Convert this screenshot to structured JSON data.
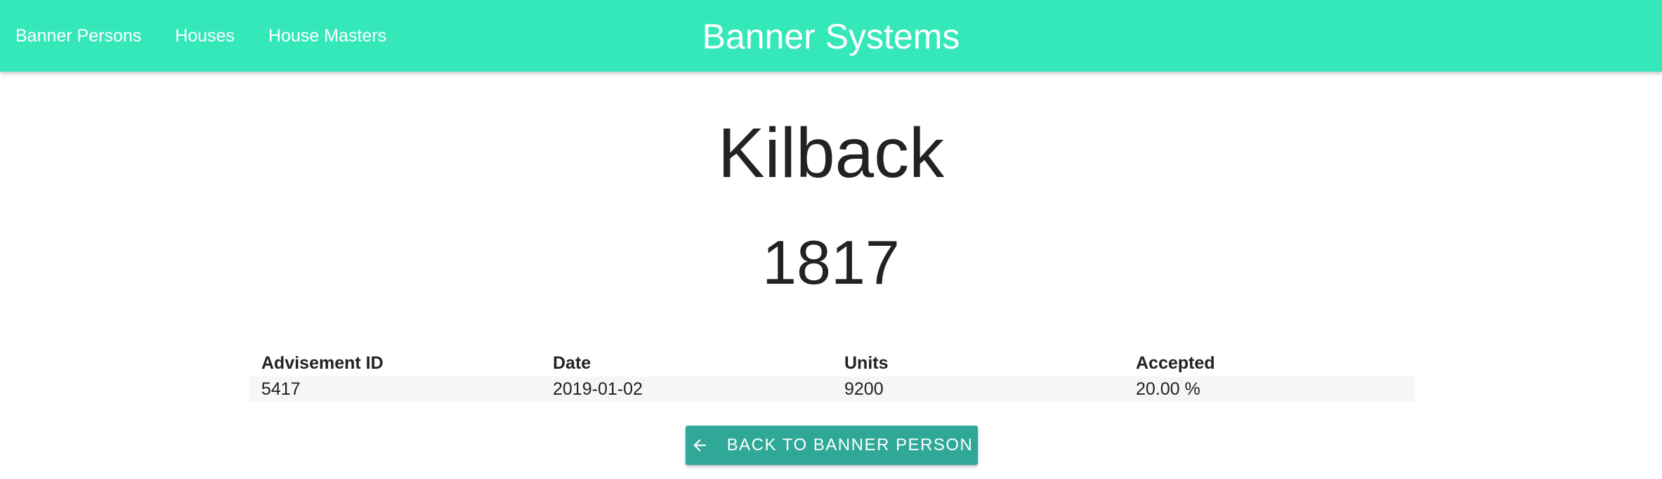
{
  "header": {
    "title": "Banner Systems",
    "nav": [
      {
        "label": "Banner Persons"
      },
      {
        "label": "Houses"
      },
      {
        "label": "House Masters"
      }
    ]
  },
  "main": {
    "name": "Kilback",
    "number": "1817",
    "table": {
      "columns": [
        "Advisement ID",
        "Date",
        "Units",
        "Accepted"
      ],
      "rows": [
        {
          "id": "5417",
          "date": "2019-01-02",
          "units": "9200",
          "accepted": "20.00 %"
        }
      ]
    },
    "back_button": {
      "label": "BACK TO BANNER PERSON",
      "icon": "arrow-left-icon"
    }
  },
  "colors": {
    "appbar": "#35e8b9",
    "button": "#2fa898"
  }
}
